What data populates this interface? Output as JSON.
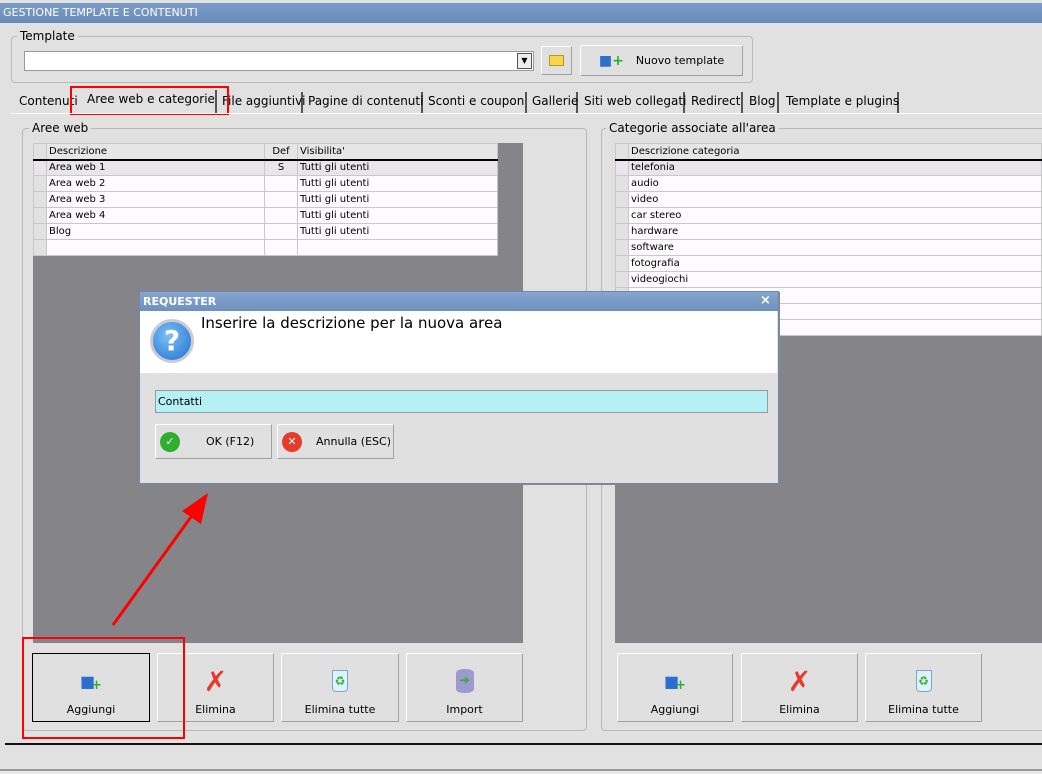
{
  "window": {
    "title": "GESTIONE TEMPLATE E CONTENUTI"
  },
  "template": {
    "label": "Template",
    "value": "",
    "new_button": "Nuovo template"
  },
  "tabs": [
    "Contenuti",
    "Aree web e categorie",
    "File aggiuntivi",
    "Pagine di contenuti",
    "Sconti e coupon",
    "Gallerie",
    "Siti web collegati",
    "Redirect",
    "Blog",
    "Template e plugins"
  ],
  "active_tab": "Aree web e categorie",
  "aree_web": {
    "label": "Aree web",
    "columns": [
      "Descrizione",
      "Def",
      "Visibilita'"
    ],
    "rows": [
      [
        "Area web 1",
        "S",
        "Tutti gli utenti"
      ],
      [
        "Area web 2",
        "",
        "Tutti gli utenti"
      ],
      [
        "Area web 3",
        "",
        "Tutti gli utenti"
      ],
      [
        "Area web 4",
        "",
        "Tutti gli utenti"
      ],
      [
        "Blog",
        "",
        "Tutti gli utenti"
      ]
    ],
    "buttons": [
      "Aggiungi",
      "Elimina",
      "Elimina tutte",
      "Import"
    ]
  },
  "categorie": {
    "label": "Categorie associate all'area",
    "columns": [
      "Descrizione categoria"
    ],
    "rows": [
      "telefonia",
      "audio",
      "video",
      "car stereo",
      "hardware",
      "software",
      "fotografia",
      "videogiochi"
    ],
    "buttons": [
      "Aggiungi",
      "Elimina",
      "Elimina tutte"
    ]
  },
  "dialog": {
    "title": "REQUESTER",
    "message": "Inserire la descrizione per la nuova area",
    "input_value": "Contatti",
    "ok": "OK (F12)",
    "cancel": "Annulla (ESC)",
    "close": "×"
  },
  "colors": {
    "annotation": "#ff0000",
    "input_bg": "#b4f0f4",
    "titlebar": "#6b8cbb"
  }
}
